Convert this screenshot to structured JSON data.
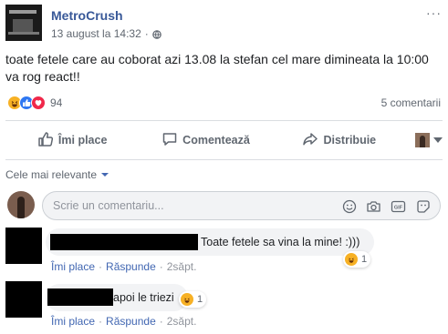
{
  "post": {
    "page_name": "MetroCrush",
    "date": "13 august la 14:32",
    "separator": "·",
    "text_line1": "toate fetele care au coborat azi 13.08 la stefan cel mare dimineata la 10:00",
    "text_line2": "va rog react!!",
    "reaction_count": "94",
    "comment_count": "5 comentarii"
  },
  "actions": {
    "like": "Îmi place",
    "comment": "Comentează",
    "share": "Distribuie"
  },
  "comments_section": {
    "sort_label": "Cele mai relevante",
    "composer_placeholder": "Scrie un comentariu..."
  },
  "comments": [
    {
      "text": "Toate fetele sa vina la mine! :)))",
      "reaction_count": "1",
      "like": "Îmi place",
      "reply": "Răspunde",
      "dot": "·",
      "time": "2săpt."
    },
    {
      "text": "apoi le triezi",
      "reaction_count": "1",
      "like": "Îmi place",
      "reply": "Răspunde",
      "dot": "·",
      "time": "2săpt."
    }
  ],
  "icons": [
    "globe-icon",
    "more-icon",
    "like-icon",
    "comment-icon",
    "share-icon",
    "emoji-icon",
    "camera-icon",
    "gif-icon",
    "sticker-icon"
  ],
  "colors": {
    "link": "#385898",
    "accent": "#4267b2",
    "secondary_text": "#606770",
    "bubble": "#f2f3f5",
    "like_blue": "#2e77f2",
    "love_red": "#f0284a",
    "haha_yellow": "#f7b125"
  }
}
